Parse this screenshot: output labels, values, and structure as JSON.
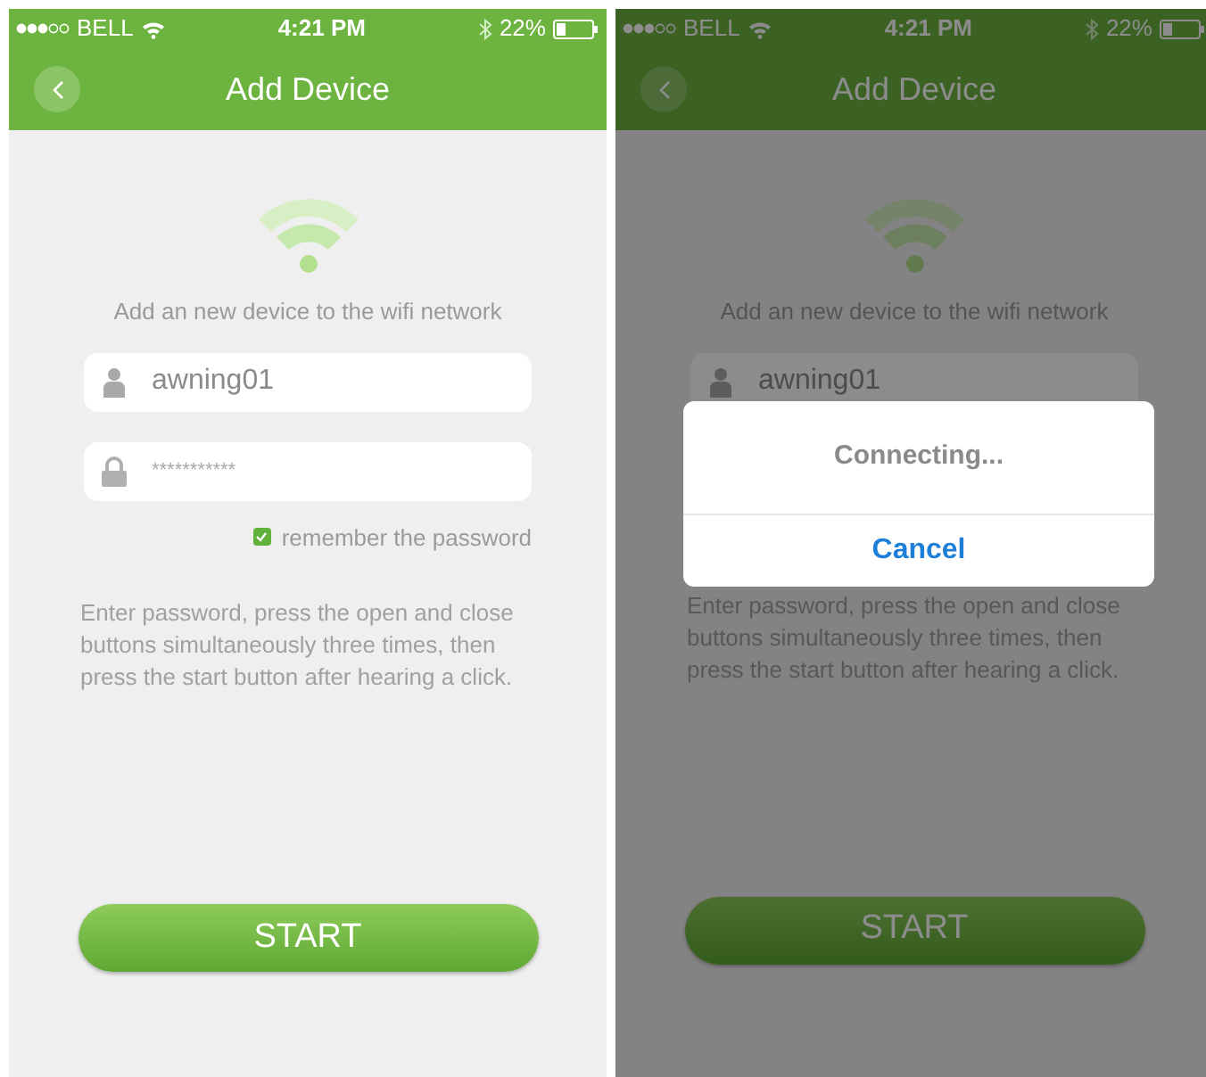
{
  "screens": [
    {
      "status_bar": {
        "carrier": "BELL",
        "time": "4:21 PM",
        "battery": "22%"
      },
      "title": "Add Device",
      "intro": "Add an new device to the wifi network",
      "fields": [
        {
          "kind": "user",
          "value": "awning01"
        },
        {
          "kind": "password",
          "value": "***********"
        }
      ],
      "remember": {
        "label": "remember the password",
        "checked": true
      },
      "instructions": "Enter password, press the open and close buttons simultaneously three times, then press the start button after hearing a click.",
      "start_button": "START"
    },
    {
      "status_bar": {
        "carrier": "BELL",
        "time": "4:21 PM",
        "battery": "22%"
      },
      "title": "Add Device",
      "intro": "Add an new device to the wifi network",
      "fields": [
        {
          "kind": "user",
          "value": "awning01"
        }
      ],
      "instructions": "Enter password, press the open and close buttons simultaneously three times, then press the start button after hearing a click.",
      "start_button": "START",
      "dialog": {
        "message": "Connecting...",
        "button": "Cancel"
      }
    }
  ]
}
